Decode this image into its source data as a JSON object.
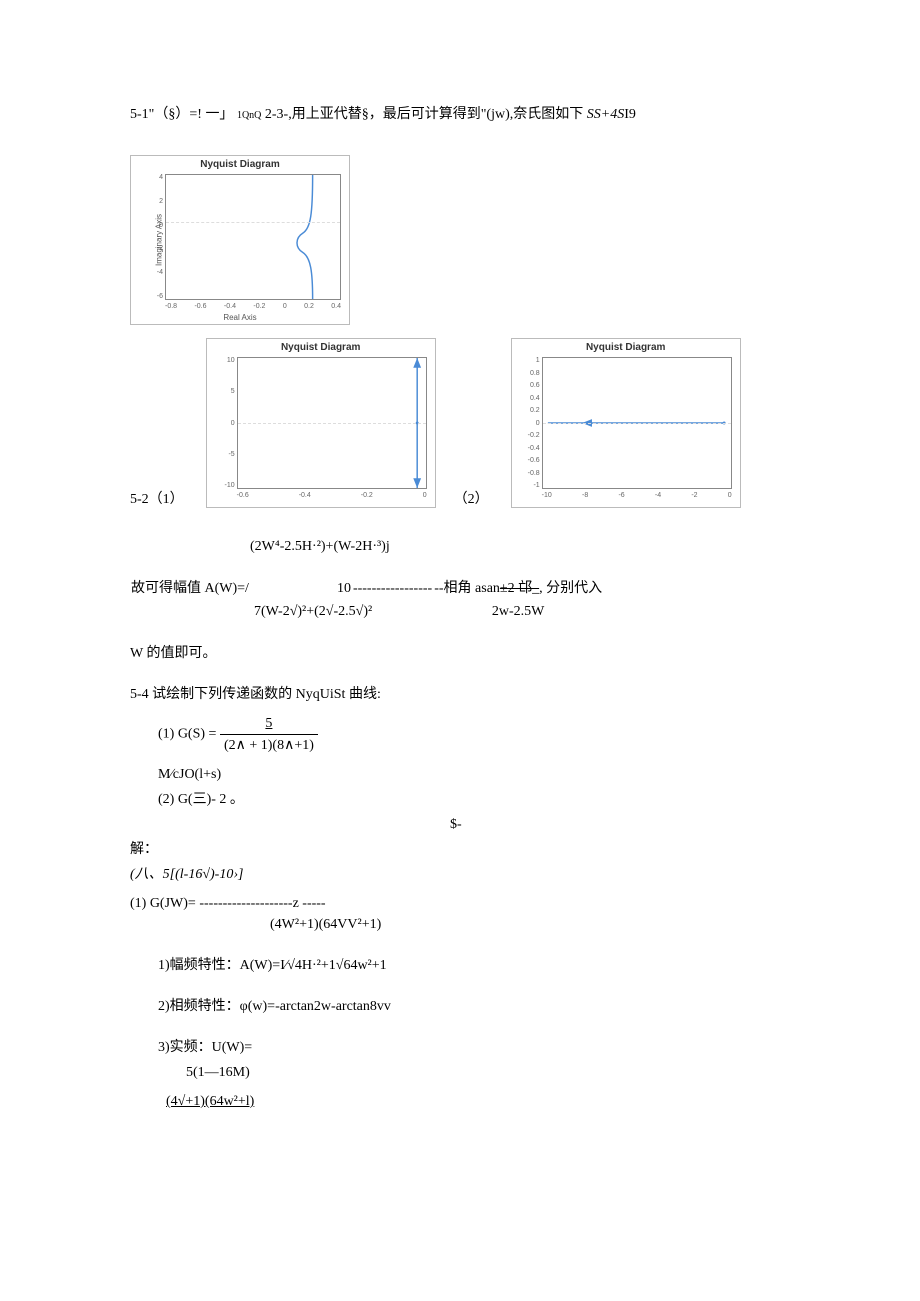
{
  "problem51": {
    "label": "5-1\"（§）=!",
    "frac_num": "1",
    "mid": "一」",
    "frac2_num": "1QnQ",
    "after": "2-3-,用上亚代替§，最后可计算得到\"(jw),奈氏图如下",
    "tail_italic": "SS+4S",
    "tail_plain": "I9"
  },
  "diagrams": {
    "d1": {
      "title": "Nyquist Diagram",
      "ylabel": "Imaginary Axis",
      "xlabel": "Real Axis",
      "yticks": [
        "4",
        "2",
        "0",
        "-2",
        "-4",
        "-6"
      ],
      "xticks": [
        "-0.8",
        "-0.6",
        "-0.4",
        "-0.2",
        "0",
        "0.2",
        "0.4"
      ]
    },
    "d2": {
      "title": "Nyquist Diagram",
      "yticks": [
        "10",
        "5",
        "0",
        "-5",
        "-10"
      ],
      "xticks": [
        "-0.6",
        "-0.4",
        "-0.2",
        "0"
      ]
    },
    "d3": {
      "title": "Nyquist Diagram",
      "yticks": [
        "1",
        "0.8",
        "0.6",
        "0.4",
        "0.2",
        "0",
        "-0.2",
        "-0.4",
        "-0.6",
        "-0.8",
        "-1"
      ],
      "xticks": [
        "-10",
        "-8",
        "-6",
        "-4",
        "-2",
        "0"
      ]
    },
    "row_caption_left": "5-2（1）",
    "row_caption_right": "（2）"
  },
  "eq1": "(2W⁴-2.5H·²)+(W-2H·³)j",
  "amplitude": {
    "prefix": "故可得幅值 A(W)=/",
    "ten": "10",
    "dashes": " ----------------- ",
    "phase_prefix": "--相角 asan",
    "phase_frac_num": "±2 邙_",
    "phase_suffix": ", 分别代入",
    "denom_left": "7(W-2√)²+(2√-2.5√)²",
    "denom_right": "2w-2.5W"
  },
  "w_note": "W 的值即可。",
  "problem54": {
    "text": "5-4 试绘制下列传递函数的 NyqUiSt 曲线:",
    "item1_label": "(1) G(S) =",
    "item1_num": "5",
    "item1_den": "(2∧ + 1)(8∧+1)",
    "mcjo": "M∕cJO(l+s)",
    "item2": "(2)   G(三)-    2         。",
    "sminus": "$-"
  },
  "solution_label": "解：",
  "sol1": {
    "line1_pre": "(八、5[(l-16√)-10›]",
    "label": "(1)    G(JW)=",
    "dashes": " --------------------z -----",
    "den": "(4W²+1)(64VV²+1)"
  },
  "sol1_sub": {
    "l1": "1)幅频特性：A(W)=I∕√4H·²+1√64w²+1",
    "l2": "2)相频特性：φ(w)=-arctan2w-arctan8vv",
    "l3": "3)实频：U(W)=",
    "l3b": "5(1—16M)",
    "l3c": "(4√+1)(64w²+l)"
  },
  "chart_data": [
    {
      "type": "line",
      "title": "Nyquist Diagram",
      "xlabel": "Real Axis",
      "ylabel": "Imaginary Axis",
      "xlim": [
        -0.8,
        0.4
      ],
      "ylim": [
        -6,
        4
      ],
      "series": [
        {
          "name": "nyquist",
          "note": "Curve approaches vertical asymptote near Re≈0.25 with two branches going to +∞ and −∞ and a small hook crossing the real axis near Re≈0.2, Im≈0."
        }
      ]
    },
    {
      "type": "line",
      "title": "Nyquist Diagram",
      "xlim": [
        -0.7,
        0.05
      ],
      "ylim": [
        -12,
        12
      ],
      "series": [
        {
          "name": "nyquist",
          "note": "Two vertical rays at Re≈0 going to +∞ and −∞ (arrows), with a tiny crossing at origin."
        }
      ]
    },
    {
      "type": "line",
      "title": "Nyquist Diagram",
      "xlim": [
        -10,
        0.5
      ],
      "ylim": [
        -1,
        1
      ],
      "series": [
        {
          "name": "nyquist",
          "note": "Segment along the real axis from about Re=-10 to Re=0 at Im≈0, with an arrowhead near Re≈-8."
        }
      ]
    }
  ]
}
